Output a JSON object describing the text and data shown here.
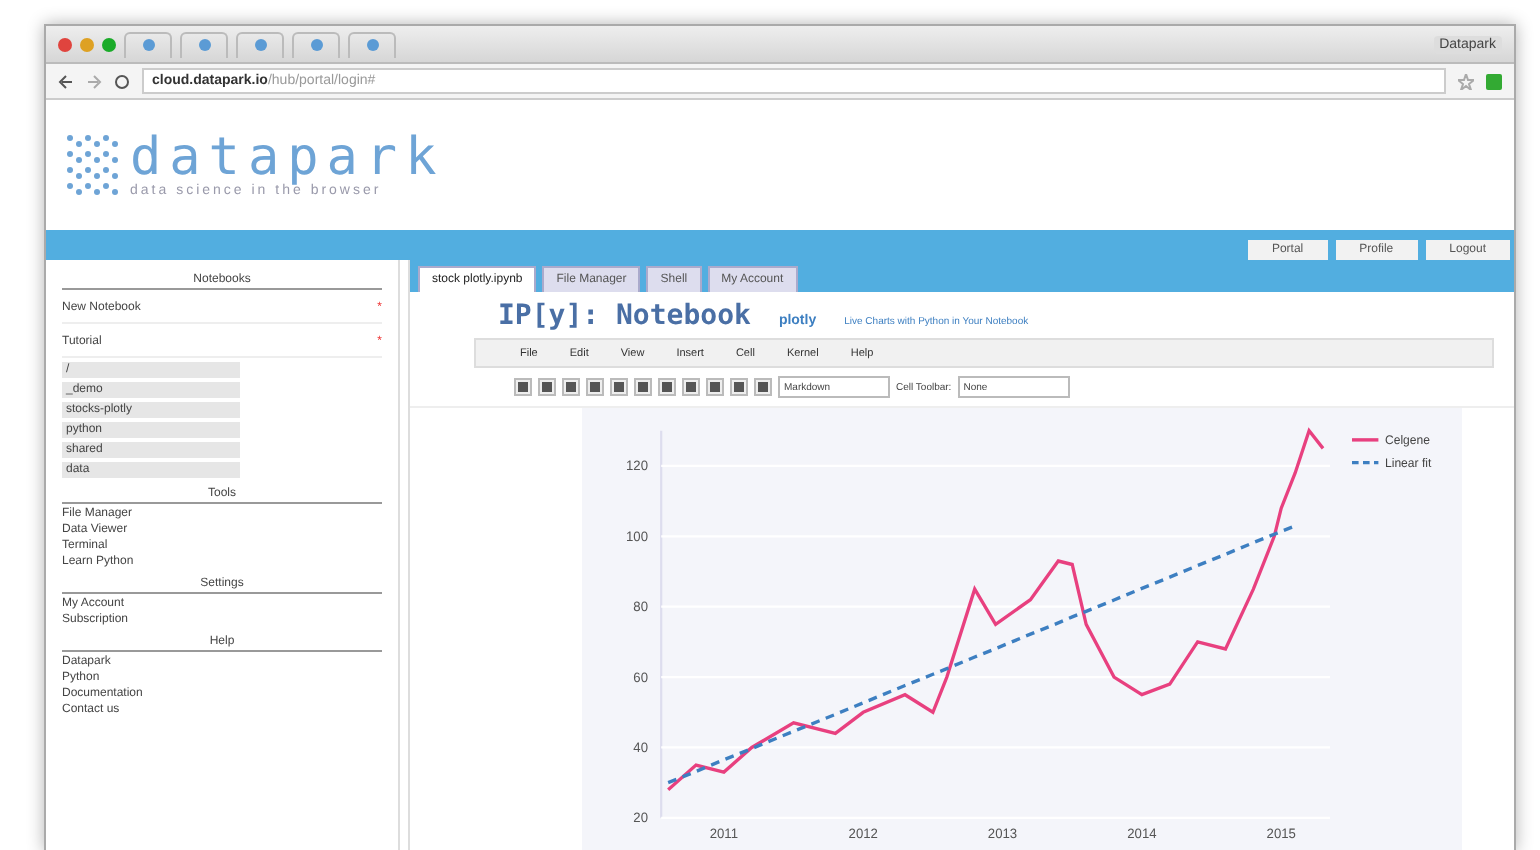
{
  "browser": {
    "address_host": "cloud.datapark.io",
    "address_path": "/hub/portal/login#",
    "user": "Datapark"
  },
  "brand": {
    "name": "datapark",
    "tagline": "data science in the browser"
  },
  "top_buttons": [
    "Portal",
    "Profile",
    "Logout"
  ],
  "sidebar": {
    "sections": [
      {
        "title": "Notebooks",
        "items": [
          {
            "label": "New Notebook",
            "kind": "action",
            "marker": "*"
          },
          {
            "label": "Tutorial",
            "kind": "action",
            "marker": "*"
          }
        ]
      },
      {
        "items": [
          {
            "label": "/",
            "kind": "file"
          },
          {
            "label": "_demo",
            "kind": "file"
          },
          {
            "label": "stocks-plotly",
            "kind": "file"
          },
          {
            "label": "python",
            "kind": "file"
          },
          {
            "label": "shared",
            "kind": "file"
          },
          {
            "label": "data",
            "kind": "file"
          }
        ]
      },
      {
        "title": "Tools",
        "items": [
          {
            "label": "File Manager",
            "kind": "link"
          },
          {
            "label": "Data Viewer",
            "kind": "link"
          },
          {
            "label": "Terminal",
            "kind": "link"
          },
          {
            "label": "Learn Python",
            "kind": "link"
          }
        ]
      },
      {
        "title": "Settings",
        "items": [
          {
            "label": "My Account",
            "kind": "link"
          },
          {
            "label": "Subscription",
            "kind": "link"
          }
        ]
      },
      {
        "title": "Help",
        "items": [
          {
            "label": "Datapark",
            "kind": "link"
          },
          {
            "label": "Python",
            "kind": "link"
          },
          {
            "label": "Documentation",
            "kind": "link"
          },
          {
            "label": "Contact us",
            "kind": "link"
          }
        ]
      }
    ]
  },
  "tabs": [
    {
      "label": "stock plotly.ipynb",
      "selected": true
    },
    {
      "label": "File Manager",
      "selected": false
    },
    {
      "label": "Shell",
      "selected": false
    },
    {
      "label": "My Account",
      "selected": false
    }
  ],
  "notebook": {
    "logo": "IP[y]: Notebook",
    "plotly_title": "plotly",
    "plotly_subtitle": "Live Charts with Python in Your Notebook",
    "menu": [
      "File",
      "Edit",
      "View",
      "Insert",
      "Cell",
      "Kernel",
      "Help"
    ],
    "cell_type": "Markdown",
    "cell_toolbar_label": "Cell Toolbar:",
    "cell_toolbar": "None"
  },
  "chart_data": {
    "type": "line",
    "xticks": [
      {
        "value": 2011,
        "label": "2011"
      },
      {
        "value": 2012,
        "label": "2012"
      },
      {
        "value": 2013,
        "label": "2013"
      },
      {
        "value": 2014,
        "label": "2014"
      },
      {
        "value": 2015,
        "label": "2015"
      }
    ],
    "yticks": [
      20,
      40,
      60,
      80,
      100,
      120
    ],
    "xlim": [
      2010.55,
      2015.35
    ],
    "ylim": [
      20,
      130
    ],
    "grid": true,
    "legend": true,
    "x": [
      2010.6,
      2010.8,
      2011.0,
      2011.2,
      2011.5,
      2011.8,
      2012.0,
      2012.3,
      2012.5,
      2012.6,
      2012.8,
      2012.95,
      2013.2,
      2013.4,
      2013.5,
      2013.6,
      2013.8,
      2014.0,
      2014.2,
      2014.4,
      2014.6,
      2014.8,
      2014.95,
      2015.0,
      2015.1,
      2015.2,
      2015.3
    ],
    "series": [
      {
        "name": "Celgene",
        "color": "#e8407f",
        "line_style": "solid",
        "values": [
          28,
          35,
          33,
          40,
          47,
          44,
          50,
          55,
          50,
          60,
          85,
          75,
          82,
          93,
          92,
          75,
          60,
          55,
          58,
          70,
          68,
          85,
          100,
          108,
          118,
          130,
          125
        ]
      },
      {
        "name": "Linear fit",
        "color": "#3d7fc1",
        "line_style": "dashed",
        "values": [
          30,
          33.2,
          36.5,
          39.7,
          44.6,
          49.4,
          52.7,
          57.6,
          60.8,
          62.4,
          65.7,
          68.1,
          72.2,
          75.4,
          77.1,
          78.7,
          81.9,
          85.2,
          88.4,
          91.7,
          94.9,
          98.2,
          100.6,
          101.4,
          103,
          null,
          null
        ]
      }
    ]
  }
}
